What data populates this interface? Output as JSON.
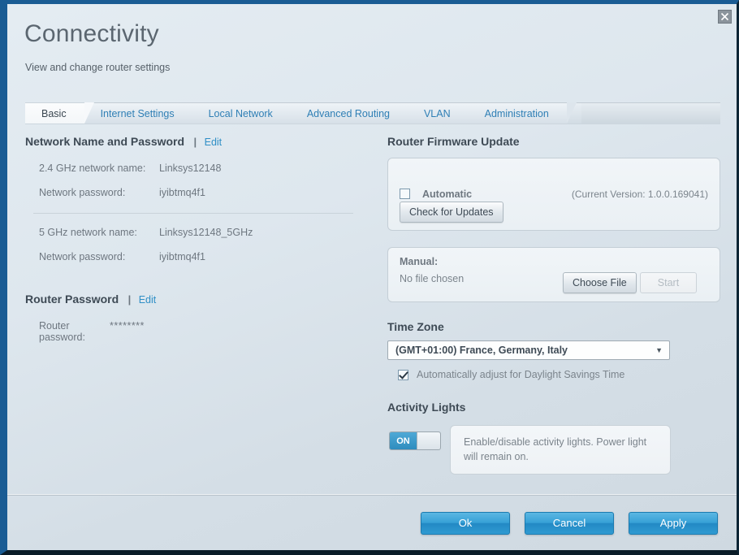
{
  "window": {
    "close_icon": "close-icon"
  },
  "header": {
    "title": "Connectivity",
    "subtitle": "View and change router settings"
  },
  "tabs": [
    {
      "label": "Basic",
      "active": true
    },
    {
      "label": "Internet Settings",
      "active": false
    },
    {
      "label": "Local Network",
      "active": false
    },
    {
      "label": "Advanced Routing",
      "active": false
    },
    {
      "label": "VLAN",
      "active": false
    },
    {
      "label": "Administration",
      "active": false
    }
  ],
  "left": {
    "network_section": {
      "heading": "Network Name and Password",
      "separator": "|",
      "edit_label": "Edit",
      "rows_24": [
        {
          "label": "2.4 GHz network name:",
          "value": "Linksys12148"
        },
        {
          "label": "Network password:",
          "value": "iyibtmq4f1"
        }
      ],
      "rows_5": [
        {
          "label": "5 GHz network name:",
          "value": "Linksys12148_5GHz"
        },
        {
          "label": "Network password:",
          "value": "iyibtmq4f1"
        }
      ]
    },
    "router_password_section": {
      "heading": "Router Password",
      "separator": "|",
      "edit_label": "Edit",
      "row": {
        "label": "Router password:",
        "value": "********"
      }
    }
  },
  "right": {
    "firmware": {
      "heading": "Router Firmware Update",
      "automatic_label": "Automatic",
      "automatic_checked": false,
      "current_version": "(Current Version: 1.0.0.169041)",
      "check_updates_label": "Check for Updates"
    },
    "manual": {
      "title": "Manual:",
      "file_status": "No file chosen",
      "choose_file_label": "Choose File",
      "start_label": "Start",
      "start_disabled": true
    },
    "time_zone": {
      "heading": "Time Zone",
      "selected": "(GMT+01:00) France, Germany, Italy",
      "caret_icon": "chevron-down-icon",
      "dst_label": "Automatically adjust for Daylight Savings Time",
      "dst_checked": true
    },
    "activity_lights": {
      "heading": "Activity Lights",
      "toggle_state": "ON",
      "note": "Enable/disable activity lights. Power light will remain on."
    }
  },
  "footer": {
    "ok_label": "Ok",
    "cancel_label": "Cancel",
    "apply_label": "Apply"
  },
  "colors": {
    "accent_blue": "#2f8fc6",
    "button_blue": "#2289c4",
    "border_dark_blue": "#1a5c94",
    "text_grey": "#6e7780",
    "heading_grey": "#3e4a55"
  }
}
